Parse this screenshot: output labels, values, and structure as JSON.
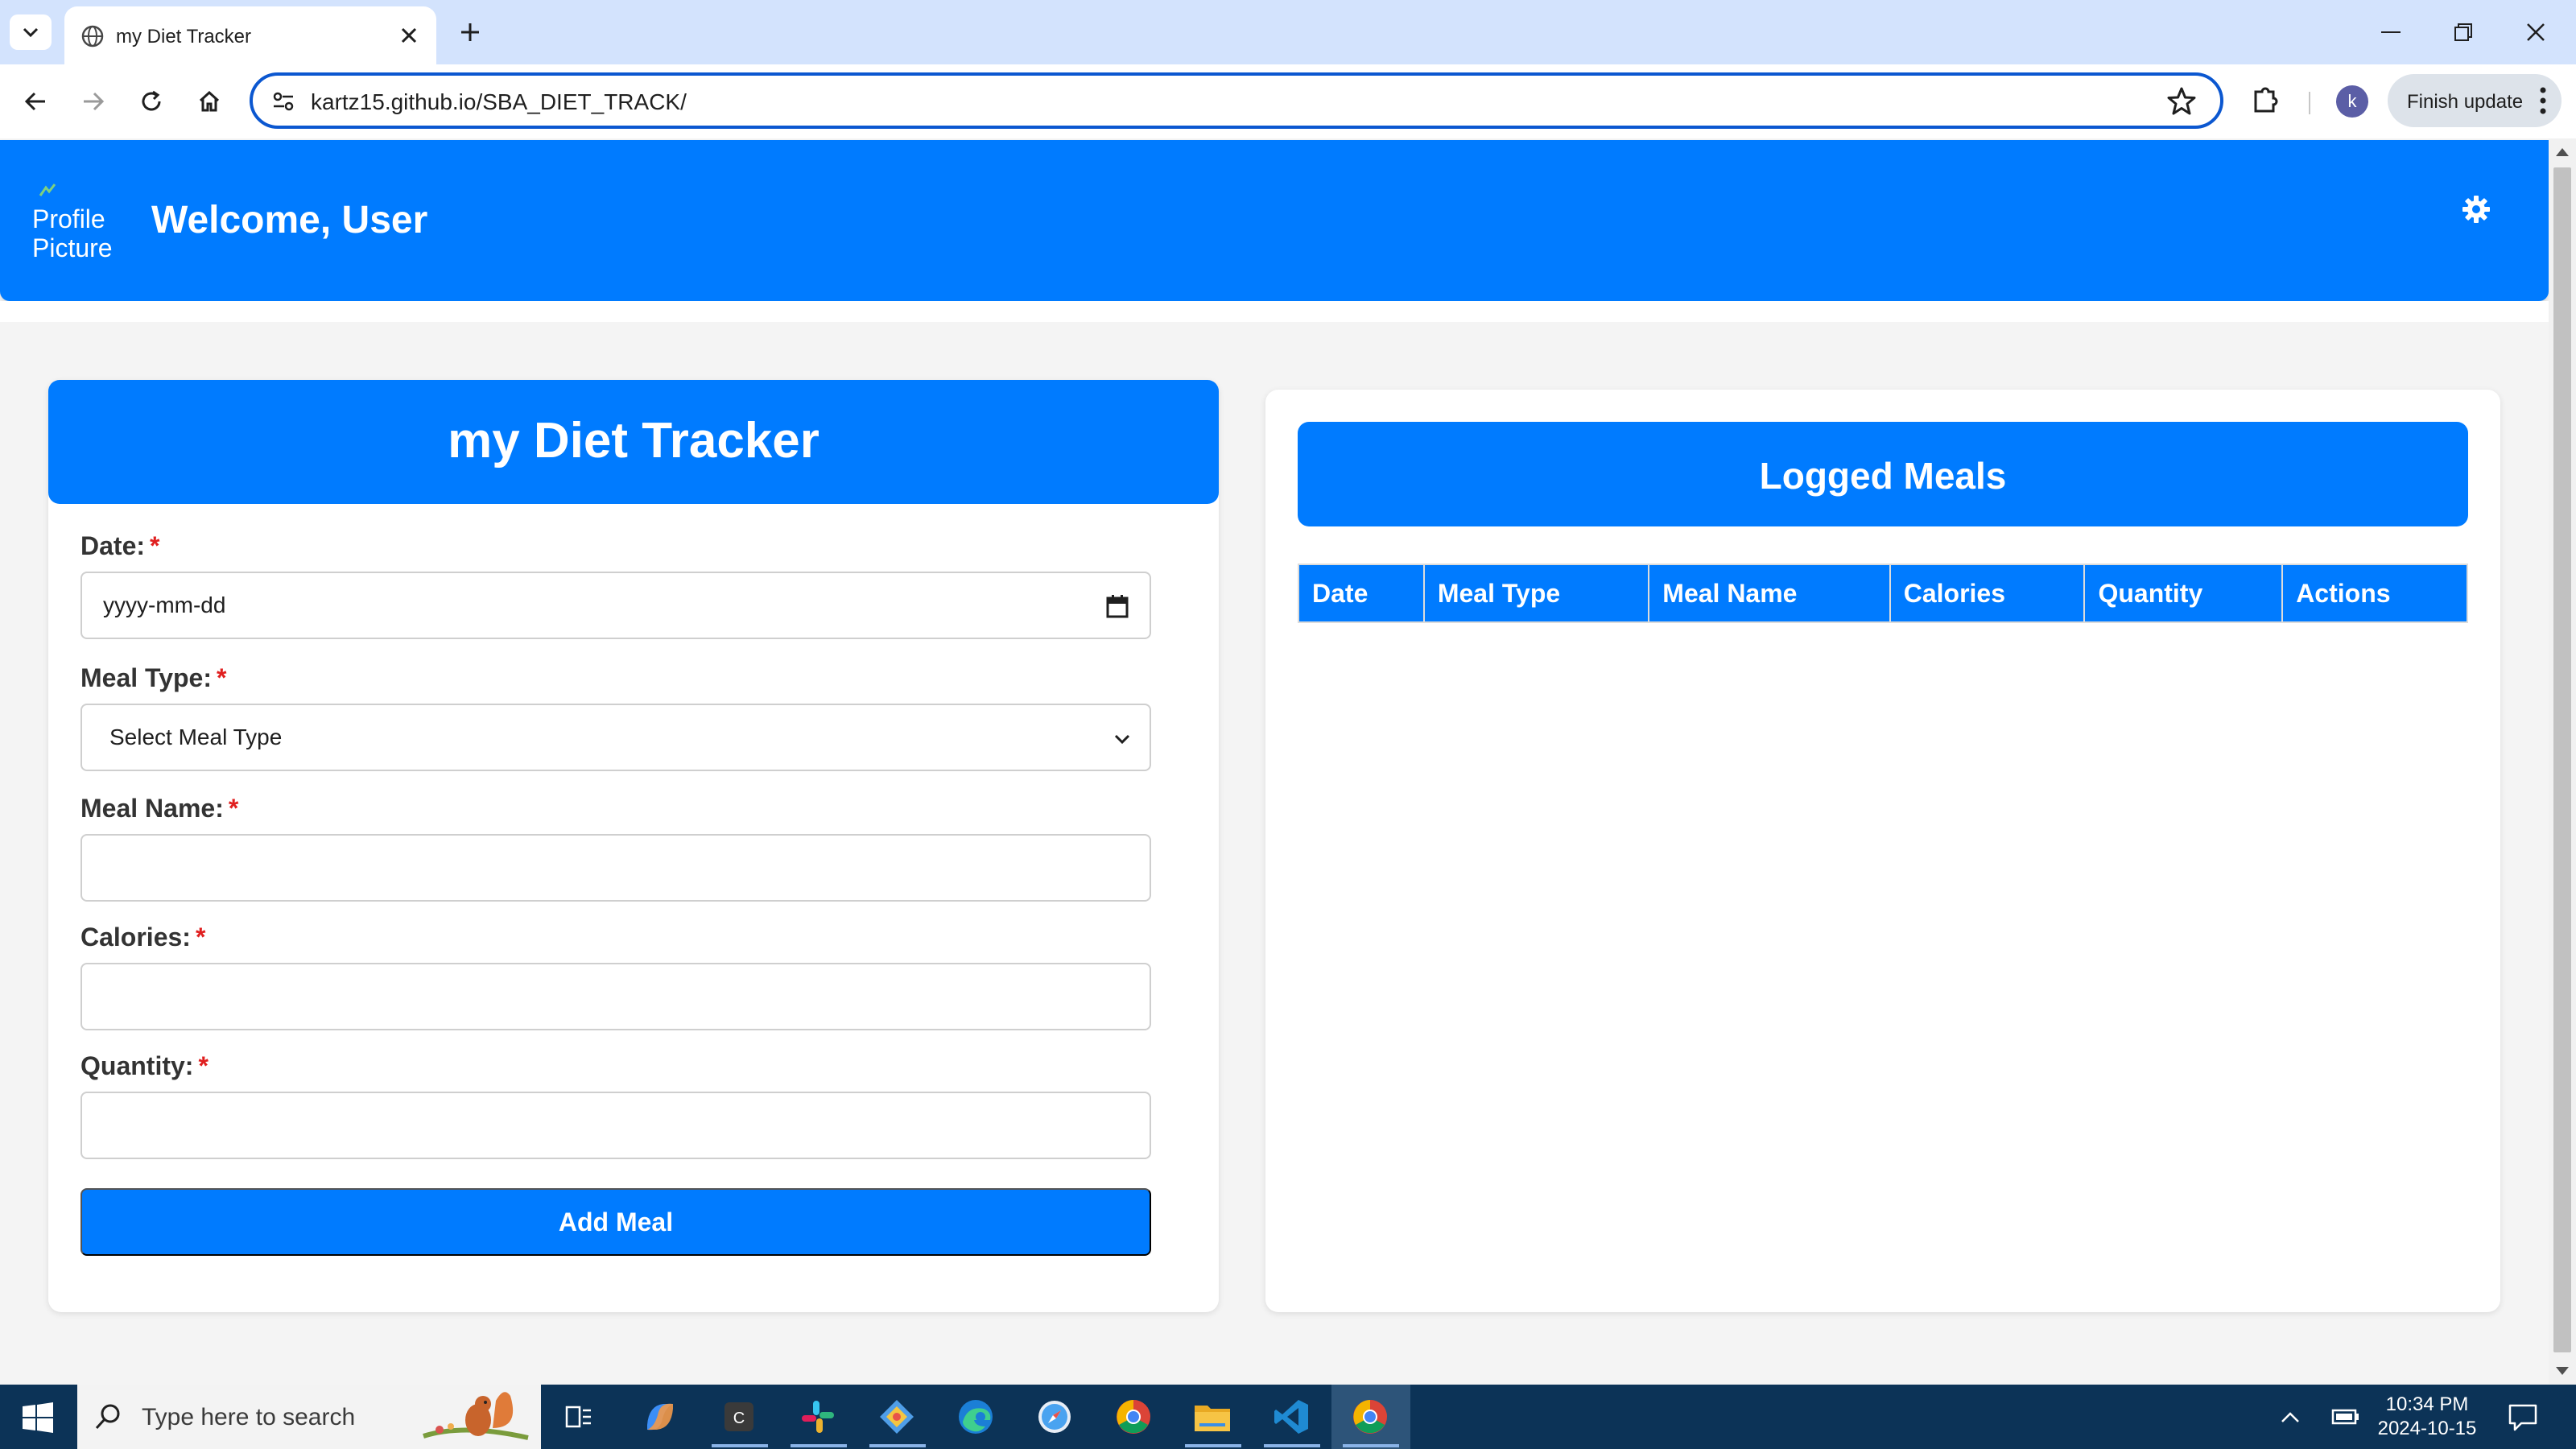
{
  "browser": {
    "tab_title": "my Diet Tracker",
    "url": "kartz15.github.io/SBA_DIET_TRACK/",
    "profile_initial": "k",
    "finish_update_label": "Finish update",
    "accent_color": "#0b57d0"
  },
  "header": {
    "profile_picture_alt": "Profile Picture",
    "welcome": "Welcome, User",
    "brand_color": "#007bff"
  },
  "form": {
    "title": "my Diet Tracker",
    "required_marker": "*",
    "date": {
      "label": "Date:",
      "value": "yyyy-mm-dd"
    },
    "meal_type": {
      "label": "Meal Type:",
      "selected": "Select Meal Type"
    },
    "meal_name": {
      "label": "Meal Name:",
      "value": ""
    },
    "calories": {
      "label": "Calories:",
      "value": ""
    },
    "quantity": {
      "label": "Quantity:",
      "value": ""
    },
    "submit_label": "Add Meal"
  },
  "meals": {
    "title": "Logged Meals",
    "columns": [
      "Date",
      "Meal Type",
      "Meal Name",
      "Calories",
      "Quantity",
      "Actions"
    ],
    "rows": []
  },
  "taskbar": {
    "search_placeholder": "Type here to search",
    "time": "10:34 PM",
    "date": "2024-10-15",
    "pinned_apps": [
      "task-view",
      "copilot",
      "c-app",
      "slack",
      "git-app",
      "edge",
      "safari",
      "chrome",
      "file-explorer",
      "vscode",
      "chrome-active"
    ]
  }
}
